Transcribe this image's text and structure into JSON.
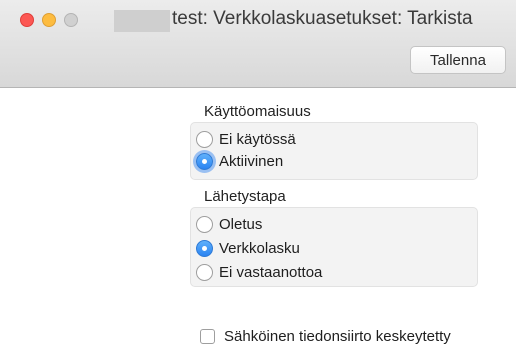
{
  "window": {
    "title": "test: Verkkolaskuasetukset: Tarkista"
  },
  "toolbar": {
    "save_label": "Tallenna"
  },
  "usage_section": {
    "label": "Käyttöomaisuus",
    "options": [
      {
        "label": "Ei käytössä",
        "selected": false
      },
      {
        "label": "Aktiivinen",
        "selected": true
      }
    ]
  },
  "delivery_section": {
    "label": "Lähetystapa",
    "options": [
      {
        "label": "Oletus",
        "selected": false
      },
      {
        "label": "Verkkolasku",
        "selected": true
      },
      {
        "label": "Ei vastaanottoa",
        "selected": false
      }
    ]
  },
  "transfer_suspended": {
    "label": "Sähköinen tiedonsiirto keskeytetty",
    "checked": false
  },
  "colors": {
    "accent": "#2a83f2",
    "close": "#fc5753",
    "minimize": "#fdbc40"
  }
}
